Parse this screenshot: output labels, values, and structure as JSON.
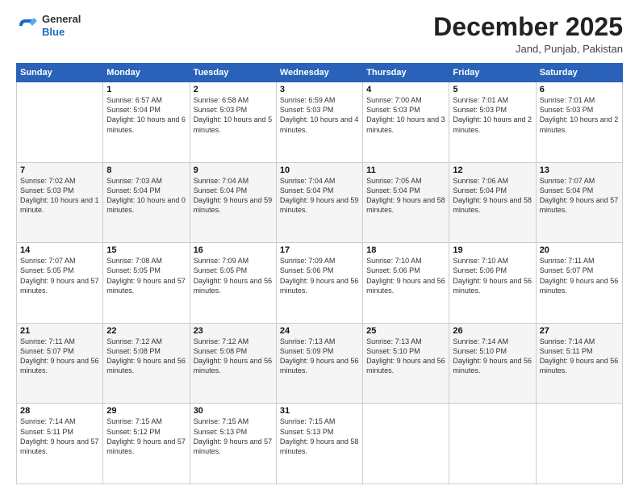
{
  "header": {
    "logo_line1": "General",
    "logo_line2": "Blue",
    "month": "December 2025",
    "location": "Jand, Punjab, Pakistan"
  },
  "days_of_week": [
    "Sunday",
    "Monday",
    "Tuesday",
    "Wednesday",
    "Thursday",
    "Friday",
    "Saturday"
  ],
  "weeks": [
    [
      {
        "day": "",
        "info": ""
      },
      {
        "day": "1",
        "info": "Sunrise: 6:57 AM\nSunset: 5:04 PM\nDaylight: 10 hours\nand 6 minutes."
      },
      {
        "day": "2",
        "info": "Sunrise: 6:58 AM\nSunset: 5:03 PM\nDaylight: 10 hours\nand 5 minutes."
      },
      {
        "day": "3",
        "info": "Sunrise: 6:59 AM\nSunset: 5:03 PM\nDaylight: 10 hours\nand 4 minutes."
      },
      {
        "day": "4",
        "info": "Sunrise: 7:00 AM\nSunset: 5:03 PM\nDaylight: 10 hours\nand 3 minutes."
      },
      {
        "day": "5",
        "info": "Sunrise: 7:01 AM\nSunset: 5:03 PM\nDaylight: 10 hours\nand 2 minutes."
      },
      {
        "day": "6",
        "info": "Sunrise: 7:01 AM\nSunset: 5:03 PM\nDaylight: 10 hours\nand 2 minutes."
      }
    ],
    [
      {
        "day": "7",
        "info": "Sunrise: 7:02 AM\nSunset: 5:03 PM\nDaylight: 10 hours\nand 1 minute."
      },
      {
        "day": "8",
        "info": "Sunrise: 7:03 AM\nSunset: 5:04 PM\nDaylight: 10 hours\nand 0 minutes."
      },
      {
        "day": "9",
        "info": "Sunrise: 7:04 AM\nSunset: 5:04 PM\nDaylight: 9 hours\nand 59 minutes."
      },
      {
        "day": "10",
        "info": "Sunrise: 7:04 AM\nSunset: 5:04 PM\nDaylight: 9 hours\nand 59 minutes."
      },
      {
        "day": "11",
        "info": "Sunrise: 7:05 AM\nSunset: 5:04 PM\nDaylight: 9 hours\nand 58 minutes."
      },
      {
        "day": "12",
        "info": "Sunrise: 7:06 AM\nSunset: 5:04 PM\nDaylight: 9 hours\nand 58 minutes."
      },
      {
        "day": "13",
        "info": "Sunrise: 7:07 AM\nSunset: 5:04 PM\nDaylight: 9 hours\nand 57 minutes."
      }
    ],
    [
      {
        "day": "14",
        "info": "Sunrise: 7:07 AM\nSunset: 5:05 PM\nDaylight: 9 hours\nand 57 minutes."
      },
      {
        "day": "15",
        "info": "Sunrise: 7:08 AM\nSunset: 5:05 PM\nDaylight: 9 hours\nand 57 minutes."
      },
      {
        "day": "16",
        "info": "Sunrise: 7:09 AM\nSunset: 5:05 PM\nDaylight: 9 hours\nand 56 minutes."
      },
      {
        "day": "17",
        "info": "Sunrise: 7:09 AM\nSunset: 5:06 PM\nDaylight: 9 hours\nand 56 minutes."
      },
      {
        "day": "18",
        "info": "Sunrise: 7:10 AM\nSunset: 5:06 PM\nDaylight: 9 hours\nand 56 minutes."
      },
      {
        "day": "19",
        "info": "Sunrise: 7:10 AM\nSunset: 5:06 PM\nDaylight: 9 hours\nand 56 minutes."
      },
      {
        "day": "20",
        "info": "Sunrise: 7:11 AM\nSunset: 5:07 PM\nDaylight: 9 hours\nand 56 minutes."
      }
    ],
    [
      {
        "day": "21",
        "info": "Sunrise: 7:11 AM\nSunset: 5:07 PM\nDaylight: 9 hours\nand 56 minutes."
      },
      {
        "day": "22",
        "info": "Sunrise: 7:12 AM\nSunset: 5:08 PM\nDaylight: 9 hours\nand 56 minutes."
      },
      {
        "day": "23",
        "info": "Sunrise: 7:12 AM\nSunset: 5:08 PM\nDaylight: 9 hours\nand 56 minutes."
      },
      {
        "day": "24",
        "info": "Sunrise: 7:13 AM\nSunset: 5:09 PM\nDaylight: 9 hours\nand 56 minutes."
      },
      {
        "day": "25",
        "info": "Sunrise: 7:13 AM\nSunset: 5:10 PM\nDaylight: 9 hours\nand 56 minutes."
      },
      {
        "day": "26",
        "info": "Sunrise: 7:14 AM\nSunset: 5:10 PM\nDaylight: 9 hours\nand 56 minutes."
      },
      {
        "day": "27",
        "info": "Sunrise: 7:14 AM\nSunset: 5:11 PM\nDaylight: 9 hours\nand 56 minutes."
      }
    ],
    [
      {
        "day": "28",
        "info": "Sunrise: 7:14 AM\nSunset: 5:11 PM\nDaylight: 9 hours\nand 57 minutes."
      },
      {
        "day": "29",
        "info": "Sunrise: 7:15 AM\nSunset: 5:12 PM\nDaylight: 9 hours\nand 57 minutes."
      },
      {
        "day": "30",
        "info": "Sunrise: 7:15 AM\nSunset: 5:13 PM\nDaylight: 9 hours\nand 57 minutes."
      },
      {
        "day": "31",
        "info": "Sunrise: 7:15 AM\nSunset: 5:13 PM\nDaylight: 9 hours\nand 58 minutes."
      },
      {
        "day": "",
        "info": ""
      },
      {
        "day": "",
        "info": ""
      },
      {
        "day": "",
        "info": ""
      }
    ]
  ]
}
